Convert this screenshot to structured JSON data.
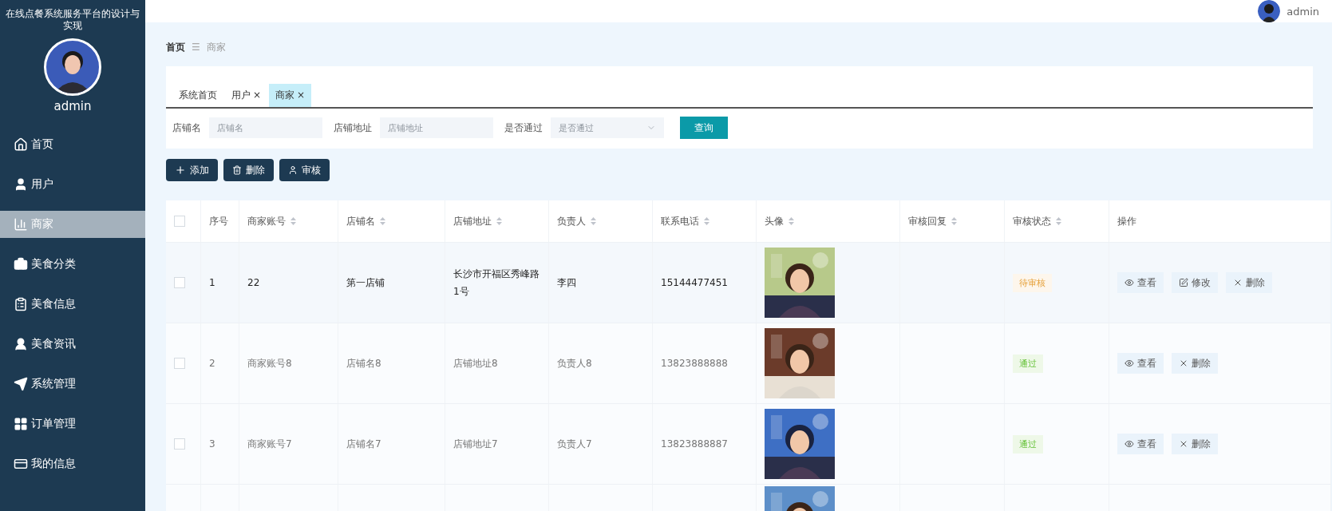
{
  "sidebar": {
    "title": "在线点餐系统服务平台的设计与实现",
    "username": "admin",
    "items": [
      {
        "label": "首页",
        "kind": "home",
        "selected": false
      },
      {
        "label": "用户",
        "kind": "user",
        "selected": false
      },
      {
        "label": "商家",
        "kind": "chart",
        "selected": true
      },
      {
        "label": "美食分类",
        "kind": "briefcase",
        "selected": false
      },
      {
        "label": "美食信息",
        "kind": "clipboard",
        "selected": false
      },
      {
        "label": "美食资讯",
        "kind": "person",
        "selected": false
      },
      {
        "label": "系统管理",
        "kind": "plane",
        "selected": false
      },
      {
        "label": "订单管理",
        "kind": "grid",
        "selected": false
      },
      {
        "label": "我的信息",
        "kind": "card",
        "selected": false
      }
    ]
  },
  "header": {
    "username": "admin"
  },
  "breadcrumb": {
    "home": "首页",
    "separator": "☰",
    "current": "商家"
  },
  "tabs": [
    {
      "label": "系统首页",
      "closable": false,
      "selected": false
    },
    {
      "label": "用户",
      "closable": true,
      "selected": false
    },
    {
      "label": "商家",
      "closable": true,
      "selected": true
    }
  ],
  "close_mark": "×",
  "filters": [
    {
      "label": "店铺名",
      "placeholder": "店铺名",
      "kind": "input"
    },
    {
      "label": "店铺地址",
      "placeholder": "店铺地址",
      "kind": "input"
    },
    {
      "label": "是否通过",
      "placeholder": "是否通过",
      "kind": "select"
    }
  ],
  "search_button": "查询",
  "actions": [
    {
      "label": "添加",
      "kind": "add"
    },
    {
      "label": "删除",
      "kind": "delete"
    },
    {
      "label": "审核",
      "kind": "audit"
    }
  ],
  "table": {
    "header_checked": false,
    "columns": [
      {
        "label": "序号",
        "sortable": false
      },
      {
        "label": "商家账号",
        "sortable": true
      },
      {
        "label": "店铺名",
        "sortable": true
      },
      {
        "label": "店铺地址",
        "sortable": true
      },
      {
        "label": "负责人",
        "sortable": true
      },
      {
        "label": "联系电话",
        "sortable": true
      },
      {
        "label": "头像",
        "sortable": true
      },
      {
        "label": "审核回复",
        "sortable": true
      },
      {
        "label": "审核状态",
        "sortable": true
      },
      {
        "label": "操作",
        "sortable": false
      }
    ],
    "rows": [
      {
        "checked": false,
        "index": "1",
        "account": "22",
        "shop": "第一店铺",
        "address": "长沙市开福区秀峰路1号",
        "owner": "李四",
        "phone": "15144477451",
        "avatar": {
          "kind": "picture"
        },
        "status": {
          "text": "待审核",
          "kind": "pending"
        },
        "buttons": [
          {
            "label": "查看",
            "kind": "view"
          },
          {
            "label": "修改",
            "kind": "edit"
          },
          {
            "label": "删除",
            "kind": "delete"
          }
        ]
      },
      {
        "checked": false,
        "index": "2",
        "account": "商家账号8",
        "shop": "店铺名8",
        "address": "店铺地址8",
        "owner": "负责人8",
        "phone": "13823888888",
        "avatar": {
          "kind": "picture"
        },
        "status": {
          "text": "通过",
          "kind": "passed"
        },
        "buttons": [
          {
            "label": "查看",
            "kind": "view"
          },
          {
            "label": "删除",
            "kind": "delete"
          }
        ]
      },
      {
        "checked": false,
        "index": "3",
        "account": "商家账号7",
        "shop": "店铺名7",
        "address": "店铺地址7",
        "owner": "负责人7",
        "phone": "13823888887",
        "avatar": {
          "kind": "picture"
        },
        "status": {
          "text": "通过",
          "kind": "passed"
        },
        "buttons": [
          {
            "label": "查看",
            "kind": "view"
          },
          {
            "label": "删除",
            "kind": "delete"
          }
        ]
      },
      {
        "avatar": {
          "kind": "picture"
        }
      }
    ]
  }
}
